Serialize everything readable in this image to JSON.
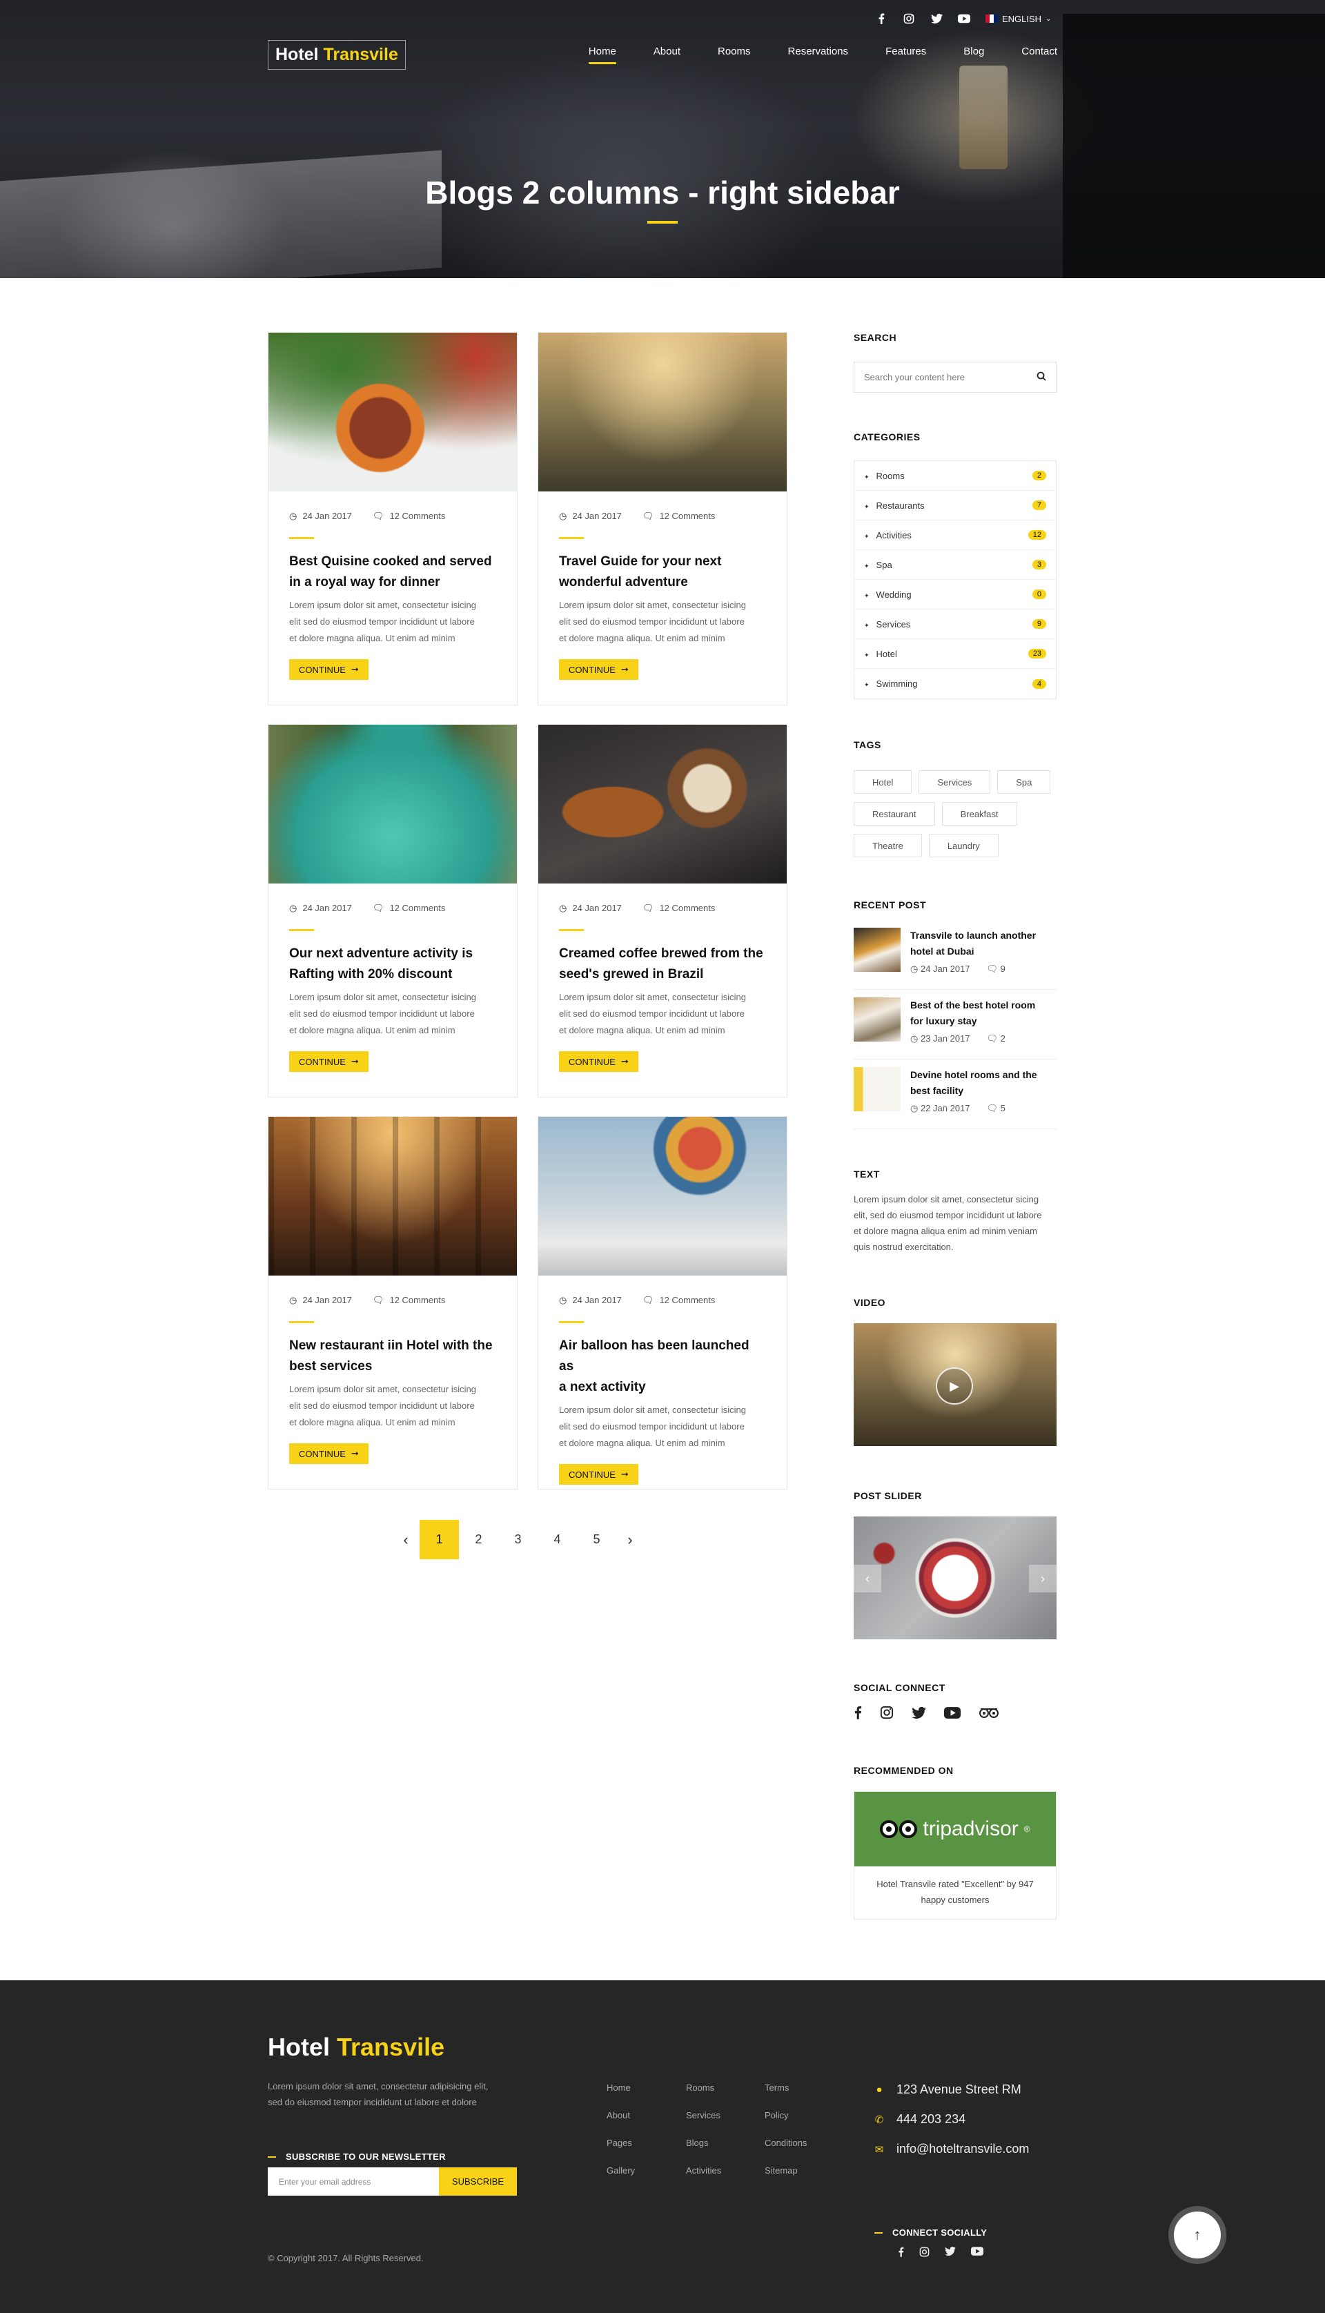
{
  "header": {
    "logo_part1": "Hotel",
    "logo_part2": "Transvile",
    "language": "ENGLISH",
    "social_icons": [
      "facebook-icon",
      "instagram-icon",
      "twitter-icon",
      "youtube-icon"
    ],
    "menu": [
      "Home",
      "About",
      "Rooms",
      "Reservations",
      "Features",
      "Blog",
      "Contact"
    ],
    "active_menu": "Home",
    "page_title": "Blogs 2 columns - right sidebar"
  },
  "posts": [
    {
      "date": "24 Jan 2017",
      "comments": "12 Comments",
      "title_1": "Best Quisine cooked and served",
      "title_2": "in a royal way for dinner",
      "excerpt_1": "Lorem ipsum dolor sit amet, consectetur  isicing",
      "excerpt_2": "elit sed do eiusmod tempor incididunt ut labore",
      "excerpt_3": "et dolore magna aliqua. Ut enim ad minim",
      "button": "CONTINUE"
    },
    {
      "date": "24 Jan 2017",
      "comments": "12 Comments",
      "title_1": "Travel Guide for your next",
      "title_2": "wonderful adventure",
      "excerpt_1": "Lorem ipsum dolor sit amet, consectetur  isicing",
      "excerpt_2": "elit sed do eiusmod tempor incididunt ut labore",
      "excerpt_3": "et dolore magna aliqua. Ut enim ad minim",
      "button": "CONTINUE"
    },
    {
      "date": "24 Jan 2017",
      "comments": "12 Comments",
      "title_1": "Our next adventure activity is",
      "title_2": "Rafting with 20% discount",
      "excerpt_1": "Lorem ipsum dolor sit amet, consectetur  isicing",
      "excerpt_2": "elit sed do eiusmod tempor incididunt ut labore",
      "excerpt_3": "et dolore magna aliqua. Ut enim ad minim",
      "button": "CONTINUE"
    },
    {
      "date": "24 Jan 2017",
      "comments": "12 Comments",
      "title_1": "Creamed coffee brewed from the",
      "title_2": "seed's grewed in Brazil",
      "excerpt_1": "Lorem ipsum dolor sit amet, consectetur  isicing",
      "excerpt_2": "elit sed do eiusmod tempor incididunt ut labore",
      "excerpt_3": "et dolore magna aliqua. Ut enim ad minim",
      "button": "CONTINUE"
    },
    {
      "date": "24 Jan 2017",
      "comments": "12 Comments",
      "title_1": "New restaurant iin Hotel with the",
      "title_2": "best services",
      "excerpt_1": "Lorem ipsum dolor sit amet, consectetur  isicing",
      "excerpt_2": "elit sed do eiusmod tempor incididunt ut labore",
      "excerpt_3": "et dolore magna aliqua. Ut enim ad minim",
      "button": "CONTINUE"
    },
    {
      "date": "24 Jan 2017",
      "comments": "12 Comments",
      "title_1": "Air balloon has been launched as",
      "title_2": "a next activity",
      "excerpt_1": "Lorem ipsum dolor sit amet, consectetur  isicing",
      "excerpt_2": "elit sed do eiusmod tempor incididunt ut labore",
      "excerpt_3": "et dolore magna aliqua. Ut enim ad minim",
      "button": "CONTINUE"
    }
  ],
  "pagination": {
    "pages": [
      "1",
      "2",
      "3",
      "4",
      "5"
    ],
    "current": "1"
  },
  "sidebar": {
    "search_title": "SEARCH",
    "search_placeholder": "Search your content here",
    "categories_title": "CATEGORIES",
    "categories": [
      {
        "name": "Rooms",
        "count": "2"
      },
      {
        "name": "Restaurants",
        "count": "7"
      },
      {
        "name": "Activities",
        "count": "12"
      },
      {
        "name": "Spa",
        "count": "3"
      },
      {
        "name": "Wedding",
        "count": "0"
      },
      {
        "name": "Services",
        "count": "9"
      },
      {
        "name": "Hotel",
        "count": "23"
      },
      {
        "name": "Swimming",
        "count": "4"
      }
    ],
    "tags_title": "TAGS",
    "tags": [
      "Hotel",
      "Services",
      "Spa",
      "Restaurant",
      "Breakfast",
      "Theatre",
      "Laundry"
    ],
    "recent_title": "RECENT POST",
    "recent_posts": [
      {
        "title_1": "Transvile to launch another",
        "title_2": "hotel at Dubai",
        "date": "24 Jan 2017",
        "comments": "9"
      },
      {
        "title_1": "Best of the best hotel room",
        "title_2": "for luxury stay",
        "date": "23 Jan 2017",
        "comments": "2"
      },
      {
        "title_1": "Devine hotel rooms and the",
        "title_2": "best facility",
        "date": "22 Jan 2017",
        "comments": "5"
      }
    ],
    "text_title": "TEXT",
    "text_1": "Lorem ipsum dolor sit amet, consectetur sicing",
    "text_2": "elit, sed do eiusmod tempor incididunt ut labore",
    "text_3": "et dolore magna aliqua enim ad minim veniam",
    "text_4": "quis nostrud exercitation.",
    "video_title": "VIDEO",
    "post_slider_title": "POST SLIDER",
    "social_title": "SOCIAL CONNECT",
    "social_icons": [
      "facebook-icon",
      "instagram-icon",
      "twitter-icon",
      "youtube-icon",
      "tripadvisor-icon"
    ],
    "recommended_title": "RECOMMENDED ON",
    "tripadvisor_logo": "tripadvisor",
    "tripadvisor_caption_1": "Hotel Transvile rated \"Excellent\" by 947",
    "tripadvisor_caption_2": "happy customers"
  },
  "footer": {
    "logo_part1": "Hotel",
    "logo_part2": "Transvile",
    "desc_1": "Lorem ipsum dolor sit amet, consectetur adipisicing elit,",
    "desc_2": "sed do eiusmod tempor incididunt ut labore et dolore",
    "newsletter_title": "SUBSCRIBE TO OUR NEWSLETTER",
    "email_placeholder": "Enter your email address",
    "subscribe_label": "SUBSCRIBE",
    "links_col1": [
      "Home",
      "About",
      "Pages",
      "Gallery"
    ],
    "links_col2": [
      "Rooms",
      "Services",
      "Blogs",
      "Activities"
    ],
    "links_col3": [
      "Terms",
      "Policy",
      "Conditions",
      "Sitemap"
    ],
    "address": "123 Avenue Street RM",
    "phone": "444  203  234",
    "email": "info@hoteltransvile.com",
    "connect_title": "CONNECT SOCIALLY",
    "copyright": "© Copyright 2017. All Rights Reserved."
  },
  "colors": {
    "accent": "#f7d217",
    "footer_bg": "#262626",
    "tripadvisor": "#589442"
  }
}
